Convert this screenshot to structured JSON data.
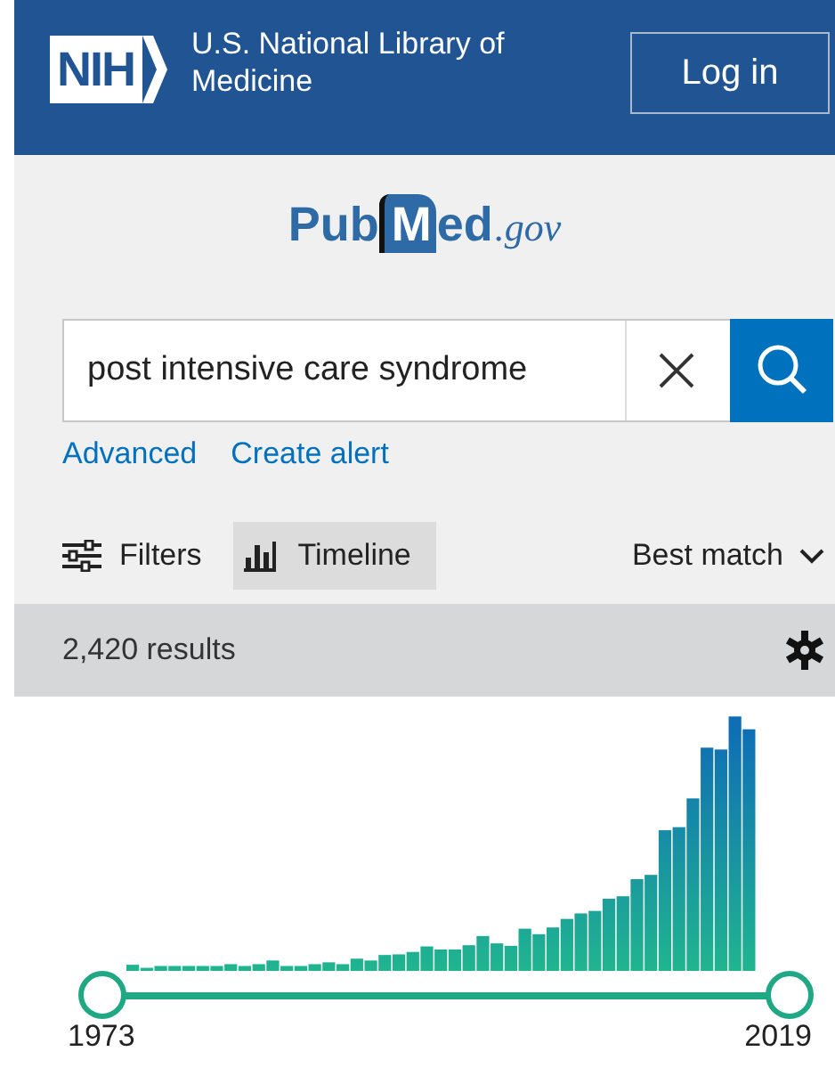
{
  "header": {
    "agency": "NIH",
    "title": "U.S. National Library of Medicine",
    "login": "Log in"
  },
  "logo": {
    "parts": [
      "Pub",
      "M",
      "ed",
      ".gov"
    ]
  },
  "search": {
    "value": "post intensive care syndrome"
  },
  "links": [
    "Advanced",
    "Create alert"
  ],
  "toolbar": {
    "filters": "Filters",
    "timeline": {
      "label": "Timeline",
      "selected": true
    },
    "sort": "Best match"
  },
  "results": {
    "count": "2,420 results"
  },
  "timeline": {
    "start_label": "1973",
    "end_label": "2019",
    "handles": [
      {
        "level": 0
      },
      {
        "level": 1
      }
    ]
  }
}
